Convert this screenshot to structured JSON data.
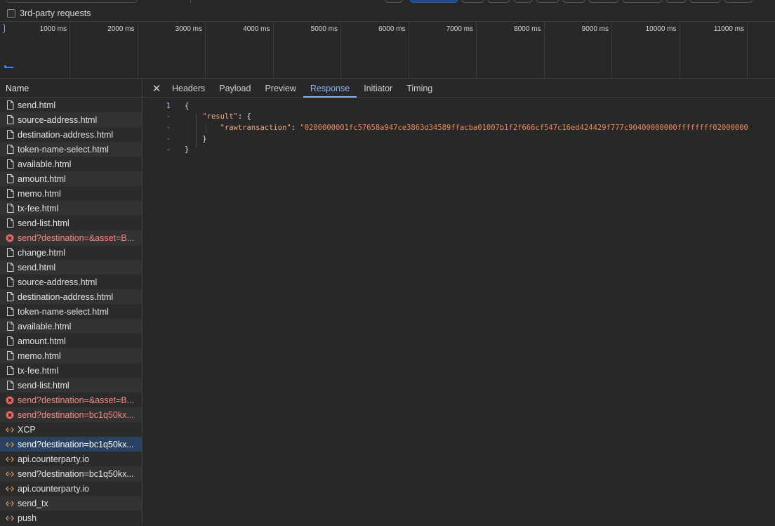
{
  "filter": {
    "third_party_label": "3rd-party requests"
  },
  "timeline": {
    "ticks": [
      "1000 ms",
      "2000 ms",
      "3000 ms",
      "4000 ms",
      "5000 ms",
      "6000 ms",
      "7000 ms",
      "8000 ms",
      "9000 ms",
      "10000 ms",
      "11000 ms"
    ]
  },
  "list": {
    "header": "Name",
    "rows": [
      {
        "label": "send.html",
        "kind": "doc"
      },
      {
        "label": "source-address.html",
        "kind": "doc"
      },
      {
        "label": "destination-address.html",
        "kind": "doc"
      },
      {
        "label": "token-name-select.html",
        "kind": "doc"
      },
      {
        "label": "available.html",
        "kind": "doc"
      },
      {
        "label": "amount.html",
        "kind": "doc"
      },
      {
        "label": "memo.html",
        "kind": "doc"
      },
      {
        "label": "tx-fee.html",
        "kind": "doc"
      },
      {
        "label": "send-list.html",
        "kind": "doc"
      },
      {
        "label": "send?destination=&asset=B...",
        "kind": "error"
      },
      {
        "label": "change.html",
        "kind": "doc"
      },
      {
        "label": "send.html",
        "kind": "doc"
      },
      {
        "label": "source-address.html",
        "kind": "doc"
      },
      {
        "label": "destination-address.html",
        "kind": "doc"
      },
      {
        "label": "token-name-select.html",
        "kind": "doc"
      },
      {
        "label": "available.html",
        "kind": "doc"
      },
      {
        "label": "amount.html",
        "kind": "doc"
      },
      {
        "label": "memo.html",
        "kind": "doc"
      },
      {
        "label": "tx-fee.html",
        "kind": "doc"
      },
      {
        "label": "send-list.html",
        "kind": "doc"
      },
      {
        "label": "send?destination=&asset=B...",
        "kind": "error"
      },
      {
        "label": "send?destination=bc1q50kx...",
        "kind": "error"
      },
      {
        "label": "XCP",
        "kind": "fetch"
      },
      {
        "label": "send?destination=bc1q50kx...",
        "kind": "fetch",
        "selected": true
      },
      {
        "label": "api.counterparty.io",
        "kind": "fetch"
      },
      {
        "label": "send?destination=bc1q50kx...",
        "kind": "fetch"
      },
      {
        "label": "api.counterparty.io",
        "kind": "fetch"
      },
      {
        "label": "send_tx",
        "kind": "fetch"
      },
      {
        "label": "push",
        "kind": "fetch"
      }
    ]
  },
  "detail": {
    "tabs": [
      {
        "label": "Headers"
      },
      {
        "label": "Payload"
      },
      {
        "label": "Preview"
      },
      {
        "label": "Response",
        "active": true
      },
      {
        "label": "Initiator"
      },
      {
        "label": "Timing"
      }
    ],
    "response": {
      "lines": [
        {
          "gutter": "1",
          "indent": "",
          "parts": [
            {
              "t": "{",
              "c": "punct"
            }
          ]
        },
        {
          "gutter": "-",
          "indent": "    ",
          "parts": [
            {
              "t": "\"result\"",
              "c": "key"
            },
            {
              "t": ": {",
              "c": "punct"
            }
          ]
        },
        {
          "gutter": "-",
          "indent": "        ",
          "parts": [
            {
              "t": "\"rawtransaction\"",
              "c": "key"
            },
            {
              "t": ": ",
              "c": "punct"
            },
            {
              "t": "\"0200000001fc57658a947ce3863d34589ffacba01007b1f2f666cf547c16ed424429f777c90400000000ffffffff02000000",
              "c": "str"
            }
          ]
        },
        {
          "gutter": "-",
          "indent": "    ",
          "parts": [
            {
              "t": "}",
              "c": "punct"
            }
          ]
        },
        {
          "gutter": "-",
          "indent": "",
          "parts": [
            {
              "t": "}",
              "c": "punct"
            }
          ]
        }
      ]
    }
  },
  "colors": {
    "background": "#282828",
    "selected_row": "#294262",
    "accent": "#8ab4f8",
    "error": "#f28b82",
    "json_key": "#f4a884",
    "json_string": "#ee8a5b"
  }
}
